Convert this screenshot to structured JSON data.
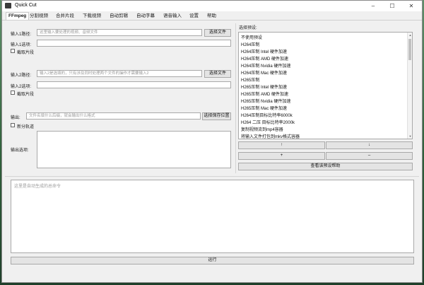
{
  "window": {
    "title": "Quick Cut",
    "minimize": "–",
    "maximize": "☐",
    "close": "✕"
  },
  "tabs": [
    "FFmpeg",
    "分割视频",
    "合并片段",
    "下载视频",
    "自动剪辑",
    "自动字幕",
    "语音输入",
    "设置",
    "帮助"
  ],
  "input1": {
    "path_label": "输入1路径:",
    "path_placeholder": "这里输入要处理的视频、音频文件",
    "choose_btn": "选择文件",
    "opt_label": "输入1选项:",
    "clip_label": "截取片段"
  },
  "input2": {
    "path_label": "输入2路径:",
    "path_placeholder": "输入2是选填的，只有涉及同时处理两个文件的操作才需要输入2",
    "choose_btn": "选择文件",
    "opt_label": "输入2选项:",
    "clip_label": "截取片段"
  },
  "output": {
    "label": "输出:",
    "placeholder": "文件名填什么后缀，就会输出什么格式",
    "choose_btn": "选择保存位置",
    "split_label": "新分轨道",
    "opt_label": "输出选项:"
  },
  "presets": {
    "label": "选择预设:",
    "items": [
      "不使用预设",
      "H264压制",
      "H264压制 Intel 硬件加速",
      "H264压制 AMD 硬件加速",
      "H264压制 Nvidia 硬件加速",
      "H264压制 Mac 硬件加速",
      "H265压制",
      "H265压制 Intel 硬件加速",
      "H265压制 AMD 硬件加速",
      "H265压制 Nvidia 硬件加速",
      "H265压制 Mac 硬件加速",
      "H264压制目标比特率6000k",
      "H264 二压 目标比特率2000k",
      "复制视频流到mp4容器",
      "将输入文件打包到mkv格式容器"
    ],
    "up_btn": "↑",
    "down_btn": "↓",
    "add_btn": "+",
    "remove_btn": "–",
    "help_btn": "查看该预设帮助"
  },
  "command": {
    "placeholder": "这里是自动生成的总命令"
  },
  "run_btn": "运行"
}
